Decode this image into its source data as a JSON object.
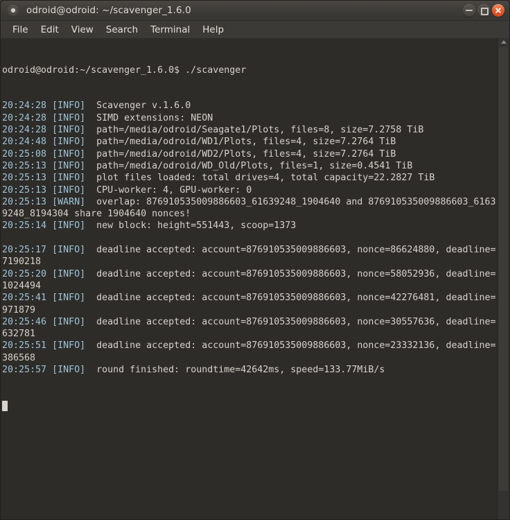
{
  "window": {
    "title": "odroid@odroid: ~/scavenger_1.6.0",
    "icon": "terminal-icon",
    "buttons": {
      "minimize": "minimize-button",
      "maximize": "maximize-button",
      "close": "close-button"
    }
  },
  "menubar": {
    "items": [
      {
        "label": "File"
      },
      {
        "label": "Edit"
      },
      {
        "label": "View"
      },
      {
        "label": "Search"
      },
      {
        "label": "Terminal"
      },
      {
        "label": "Help"
      }
    ]
  },
  "terminal": {
    "prompt_line": "odroid@odroid:~/scavenger_1.6.0$ ./scavenger",
    "cursor_visible": true,
    "lines": [
      {
        "time": "20:24:28",
        "level": "[INFO]",
        "message": "Scavenger v.1.6.0"
      },
      {
        "time": "20:24:28",
        "level": "[INFO]",
        "message": "SIMD extensions: NEON"
      },
      {
        "time": "20:24:28",
        "level": "[INFO]",
        "message": "path=/media/odroid/Seagate1/Plots, files=8, size=7.2758 TiB"
      },
      {
        "time": "20:24:48",
        "level": "[INFO]",
        "message": "path=/media/odroid/WD1/Plots, files=4, size=7.2764 TiB"
      },
      {
        "time": "20:25:08",
        "level": "[INFO]",
        "message": "path=/media/odroid/WD2/Plots, files=4, size=7.2764 TiB"
      },
      {
        "time": "20:25:13",
        "level": "[INFO]",
        "message": "path=/media/odroid/WD_Old/Plots, files=1, size=0.4541 TiB"
      },
      {
        "time": "20:25:13",
        "level": "[INFO]",
        "message": "plot files loaded: total drives=4, total capacity=22.2827 TiB"
      },
      {
        "time": "20:25:13",
        "level": "[INFO]",
        "message": "CPU-worker: 4, GPU-worker: 0"
      },
      {
        "time": "20:25:13",
        "level": "[WARN]",
        "message": "overlap: 876910535009886603_61639248_1904640 and 876910535009886603_61639248_8194304 share 1904640 nonces!"
      },
      {
        "time": "20:25:14",
        "level": "[INFO]",
        "message": "new block: height=551443, scoop=1373"
      },
      {
        "time": "",
        "level": "",
        "message": ""
      },
      {
        "time": "20:25:17",
        "level": "[INFO]",
        "message": "deadline accepted: account=876910535009886603, nonce=86624880, deadline=7190218"
      },
      {
        "time": "20:25:20",
        "level": "[INFO]",
        "message": "deadline accepted: account=876910535009886603, nonce=58052936, deadline=1024494"
      },
      {
        "time": "20:25:41",
        "level": "[INFO]",
        "message": "deadline accepted: account=876910535009886603, nonce=42276481, deadline=971879"
      },
      {
        "time": "20:25:46",
        "level": "[INFO]",
        "message": "deadline accepted: account=876910535009886603, nonce=30557636, deadline=632781"
      },
      {
        "time": "20:25:51",
        "level": "[INFO]",
        "message": "deadline accepted: account=876910535009886603, nonce=23332136, deadline=386568"
      },
      {
        "time": "20:25:57",
        "level": "[INFO]",
        "message": "round finished: roundtime=42642ms, speed=133.77MiB/s"
      }
    ]
  },
  "scrollbar": {
    "up_arrow": "scroll-up-arrow-icon"
  },
  "colors": {
    "terminal_background": "#2e2c29",
    "terminal_text": "#d6d2cb",
    "timestamp_text": "#9fc3d6",
    "titlebar_background": "#3c3a36",
    "close_button": "#e2562a"
  }
}
